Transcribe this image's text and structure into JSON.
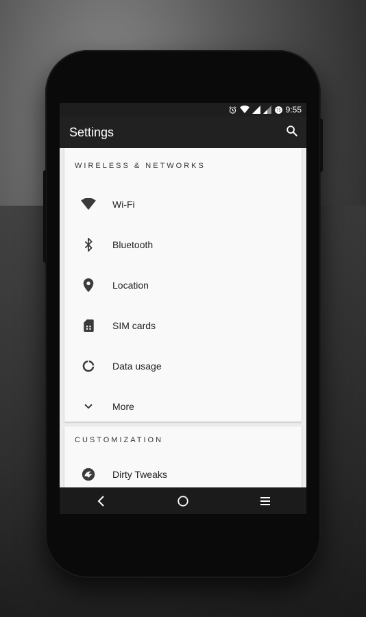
{
  "status_bar": {
    "time": "9:55"
  },
  "app_bar": {
    "title": "Settings",
    "search_icon": "search-icon"
  },
  "sections": [
    {
      "header": "WIRELESS & NETWORKS",
      "items": [
        {
          "label": "Wi-Fi",
          "icon": "wifi-icon"
        },
        {
          "label": "Bluetooth",
          "icon": "bluetooth-icon"
        },
        {
          "label": "Location",
          "icon": "location-pin-icon"
        },
        {
          "label": "SIM cards",
          "icon": "sim-card-icon"
        },
        {
          "label": "Data usage",
          "icon": "data-usage-icon"
        },
        {
          "label": "More",
          "icon": "chevron-down-icon"
        }
      ]
    },
    {
      "header": "CUSTOMIZATION",
      "items": [
        {
          "label": "Dirty Tweaks",
          "icon": "dirty-tweaks-icon"
        }
      ]
    }
  ],
  "nav_bar": {
    "back": "back-icon",
    "home": "home-icon",
    "recents": "recents-icon"
  },
  "colors": {
    "status_bar": "#1e1e1e",
    "app_bar": "#212121",
    "card": "#f9f9f9",
    "screen_bg": "#ececec",
    "nav_bar": "#1b1b1b"
  }
}
